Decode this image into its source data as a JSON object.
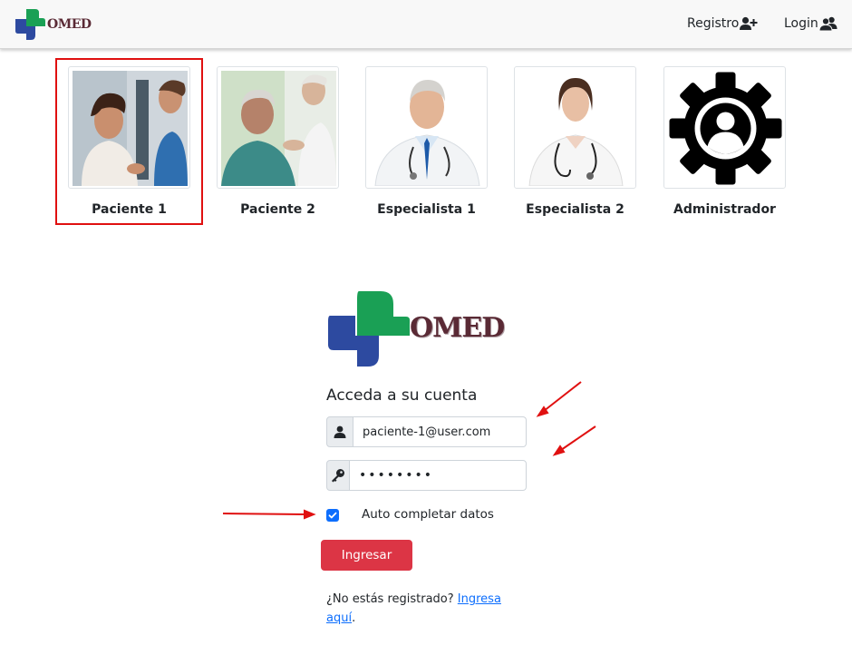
{
  "navbar": {
    "brand_text": "OMED",
    "registro_label": "Registro",
    "login_label": "Login"
  },
  "quick_access": [
    {
      "label": "Paciente 1"
    },
    {
      "label": "Paciente 2"
    },
    {
      "label": "Especialista 1"
    },
    {
      "label": "Especialista 2"
    },
    {
      "label": "Administrador"
    }
  ],
  "login_form": {
    "logo_text": "OMED",
    "title": "Acceda a su cuenta",
    "email_value": "paciente-1@user.com",
    "password_value": "••••••••",
    "autocomplete_label": "Auto completar datos",
    "autocomplete_checked": true,
    "submit_label": "Ingresar",
    "register_prompt": "¿No estás registrado? ",
    "register_link": "Ingresa aquí",
    "register_suffix": "."
  },
  "colors": {
    "brand_green": "#1aa055",
    "brand_blue": "#2d4aa0",
    "brand_text": "#5a2a35",
    "button": "#dc3545",
    "checkbox": "#0d6efd",
    "highlight": "#e01010"
  },
  "icons": {
    "registro": "user-plus-icon",
    "login": "users-icon",
    "email": "user-icon",
    "password": "key-icon"
  }
}
